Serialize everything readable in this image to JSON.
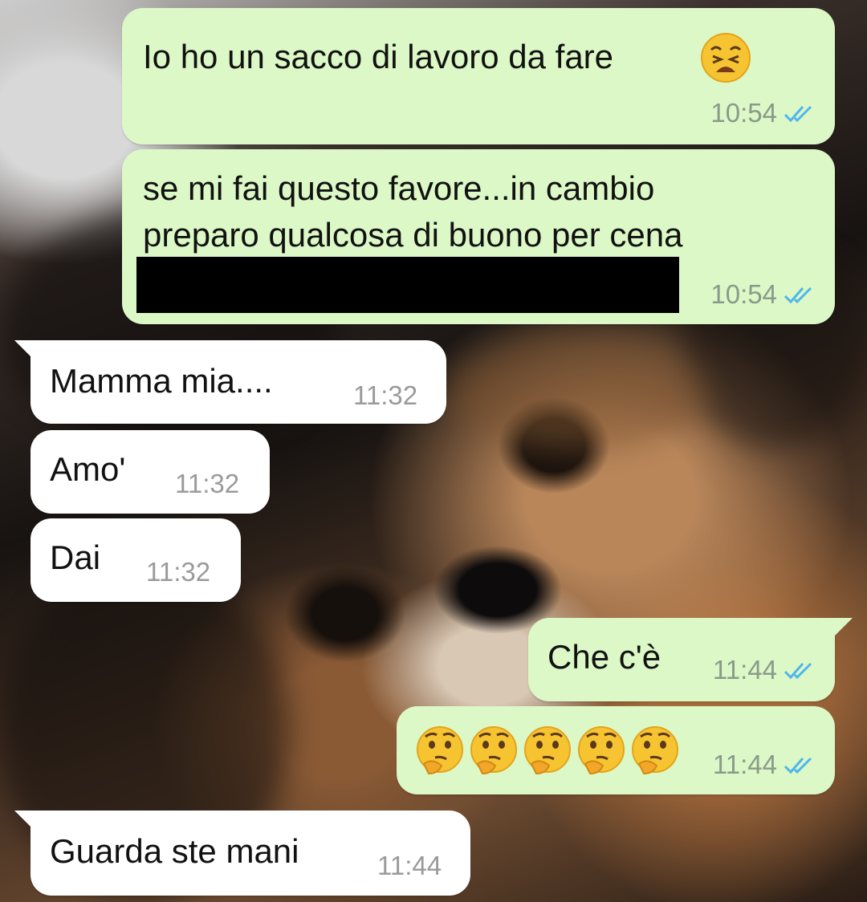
{
  "messages": [
    {
      "direction": "outgoing",
      "text": "Io ho un sacco di lavoro da fare",
      "emoji": "weary-face-emoji",
      "time": "10:54",
      "status": "read"
    },
    {
      "direction": "outgoing",
      "text": "se mi fai questo favore...in cambio\npreparo qualcosa di buono per cena",
      "redacted": true,
      "time": "10:54",
      "status": "read"
    },
    {
      "direction": "incoming",
      "text": "Mamma mia....",
      "time": "11:32"
    },
    {
      "direction": "incoming",
      "text": "Amo'",
      "time": "11:32"
    },
    {
      "direction": "incoming",
      "text": "Dai",
      "time": "11:32"
    },
    {
      "direction": "outgoing",
      "text": "Che c'è",
      "time": "11:44",
      "status": "read"
    },
    {
      "direction": "outgoing",
      "emojis": [
        "thinking-face-emoji",
        "thinking-face-emoji",
        "thinking-face-emoji",
        "thinking-face-emoji",
        "thinking-face-emoji"
      ],
      "time": "11:44",
      "status": "read"
    },
    {
      "direction": "incoming",
      "text": "Guarda ste mani",
      "time": "11:44"
    }
  ],
  "colors": {
    "outgoing_bubble": "#dcf8c6",
    "incoming_bubble": "#ffffff",
    "read_ticks": "#4fb6ec",
    "timestamp": "#8a9a8a"
  },
  "wallpaper": "pomeranian-dog-photo"
}
